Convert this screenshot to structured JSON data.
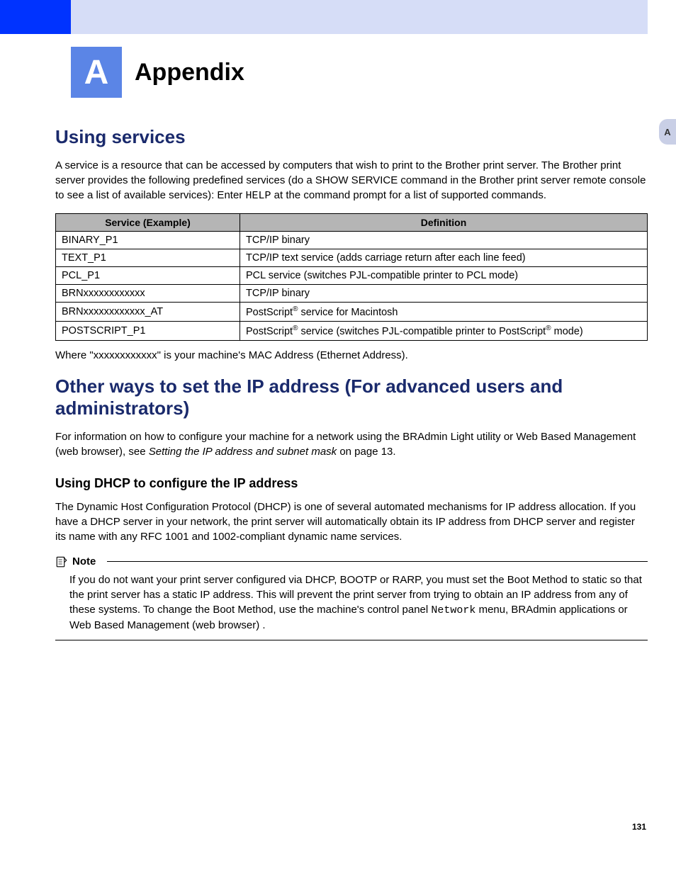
{
  "header": {
    "badge": "A",
    "title": "Appendix",
    "sideTab": "A"
  },
  "section1": {
    "heading": "Using services",
    "intro_pre": "A service is a resource that can be accessed by computers that wish to print to the Brother print server. The Brother print server provides the following predefined services (do a SHOW SERVICE command in the Brother print server remote console to see a list of available services): Enter ",
    "intro_code": "HELP",
    "intro_post": " at the command prompt for a list of supported commands.",
    "table": {
      "headers": [
        "Service (Example)",
        "Definition"
      ],
      "rows": [
        {
          "service": "BINARY_P1",
          "def": "TCP/IP binary"
        },
        {
          "service": "TEXT_P1",
          "def": "TCP/IP text service (adds carriage return after each line feed)"
        },
        {
          "service": "PCL_P1",
          "def": "PCL service (switches PJL-compatible printer to PCL mode)"
        },
        {
          "service": "BRNxxxxxxxxxxxx",
          "def": "TCP/IP binary"
        },
        {
          "service": "BRNxxxxxxxxxxxx_AT",
          "def_pre": "PostScript",
          "def_sup1": "®",
          "def_post": " service for Macintosh"
        },
        {
          "service": "POSTSCRIPT_P1",
          "def_pre": "PostScript",
          "def_sup1": "®",
          "def_mid": " service (switches PJL-compatible printer to PostScript",
          "def_sup2": "®",
          "def_post": " mode)"
        }
      ]
    },
    "footnote": "Where \"xxxxxxxxxxxx\" is your machine's MAC Address (Ethernet Address)."
  },
  "section2": {
    "heading": "Other ways to set the IP address (For advanced users and administrators)",
    "intro_pre": "For information on how to configure your machine for a network using the BRAdmin Light utility or Web Based Management (web browser), see ",
    "intro_link": "Setting the IP address and subnet mask",
    "intro_post": " on page 13.",
    "sub_heading": "Using DHCP to configure the IP address",
    "sub_body": "The Dynamic Host Configuration Protocol (DHCP) is one of several automated mechanisms for IP address allocation. If you have a DHCP server in your network, the print server will automatically obtain its IP address from DHCP server and register its name with any RFC 1001 and 1002-compliant dynamic name services.",
    "note": {
      "label": "Note",
      "body_pre": "If you do not want your print server configured via DHCP, BOOTP or RARP, you must set the Boot Method to static so that the print server has a static IP address. This will prevent the print server from trying to obtain an IP address from any of these systems. To change the Boot Method, use the machine's control panel ",
      "body_code": "Network",
      "body_post": " menu, BRAdmin applications or Web Based Management (web browser) ."
    }
  },
  "pageNumber": "131"
}
